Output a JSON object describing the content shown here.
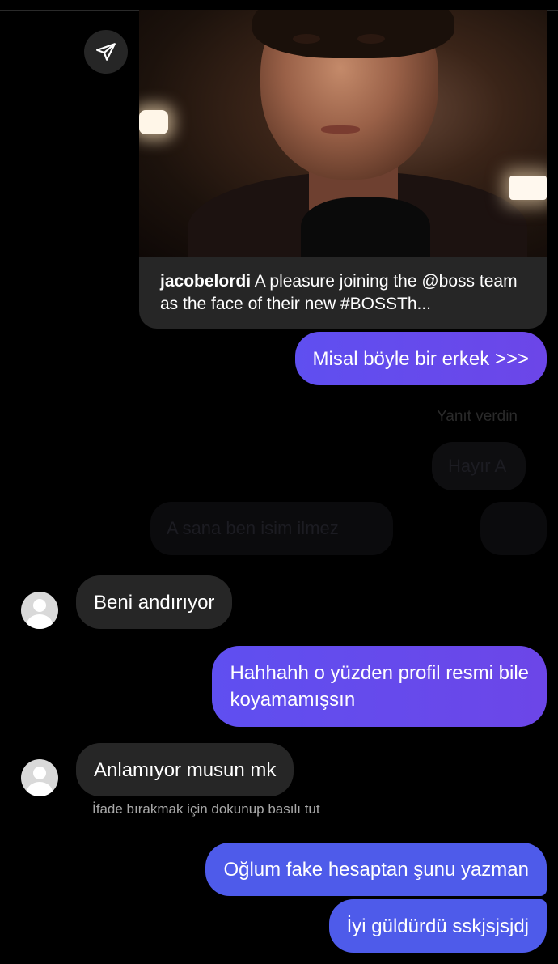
{
  "shared_post": {
    "username": "jacobelordi",
    "caption": "A pleasure joining the @boss team as the face of their new #BOSSTh..."
  },
  "messages": [
    {
      "side": "out",
      "text": "Misal böyle bir erkek >>>"
    },
    {
      "side": "in",
      "text": "Beni andırıyor"
    },
    {
      "side": "out",
      "text": "Hahhahh o yüzden profil resmi bile\nkoyamamışsın"
    },
    {
      "side": "in",
      "text": "Anlamıyor musun mk"
    },
    {
      "side": "out",
      "text": "Oğlum fake hesaptan şunu yazman"
    },
    {
      "side": "out",
      "text": "İyi güldürdü sskjsjsjdj"
    }
  ],
  "faded_reply": {
    "label": "Yanıt verdin",
    "quoted": "Hayır A",
    "message": "A sana ben isim ilmez"
  },
  "reaction_hint": "İfade bırakmak için dokunup basılı tut",
  "icons": [
    "share-icon",
    "avatar-icon"
  ],
  "colors": {
    "outgoing_bubble": "#6c4ae8",
    "incoming_bubble": "#262626",
    "background": "#000000"
  }
}
